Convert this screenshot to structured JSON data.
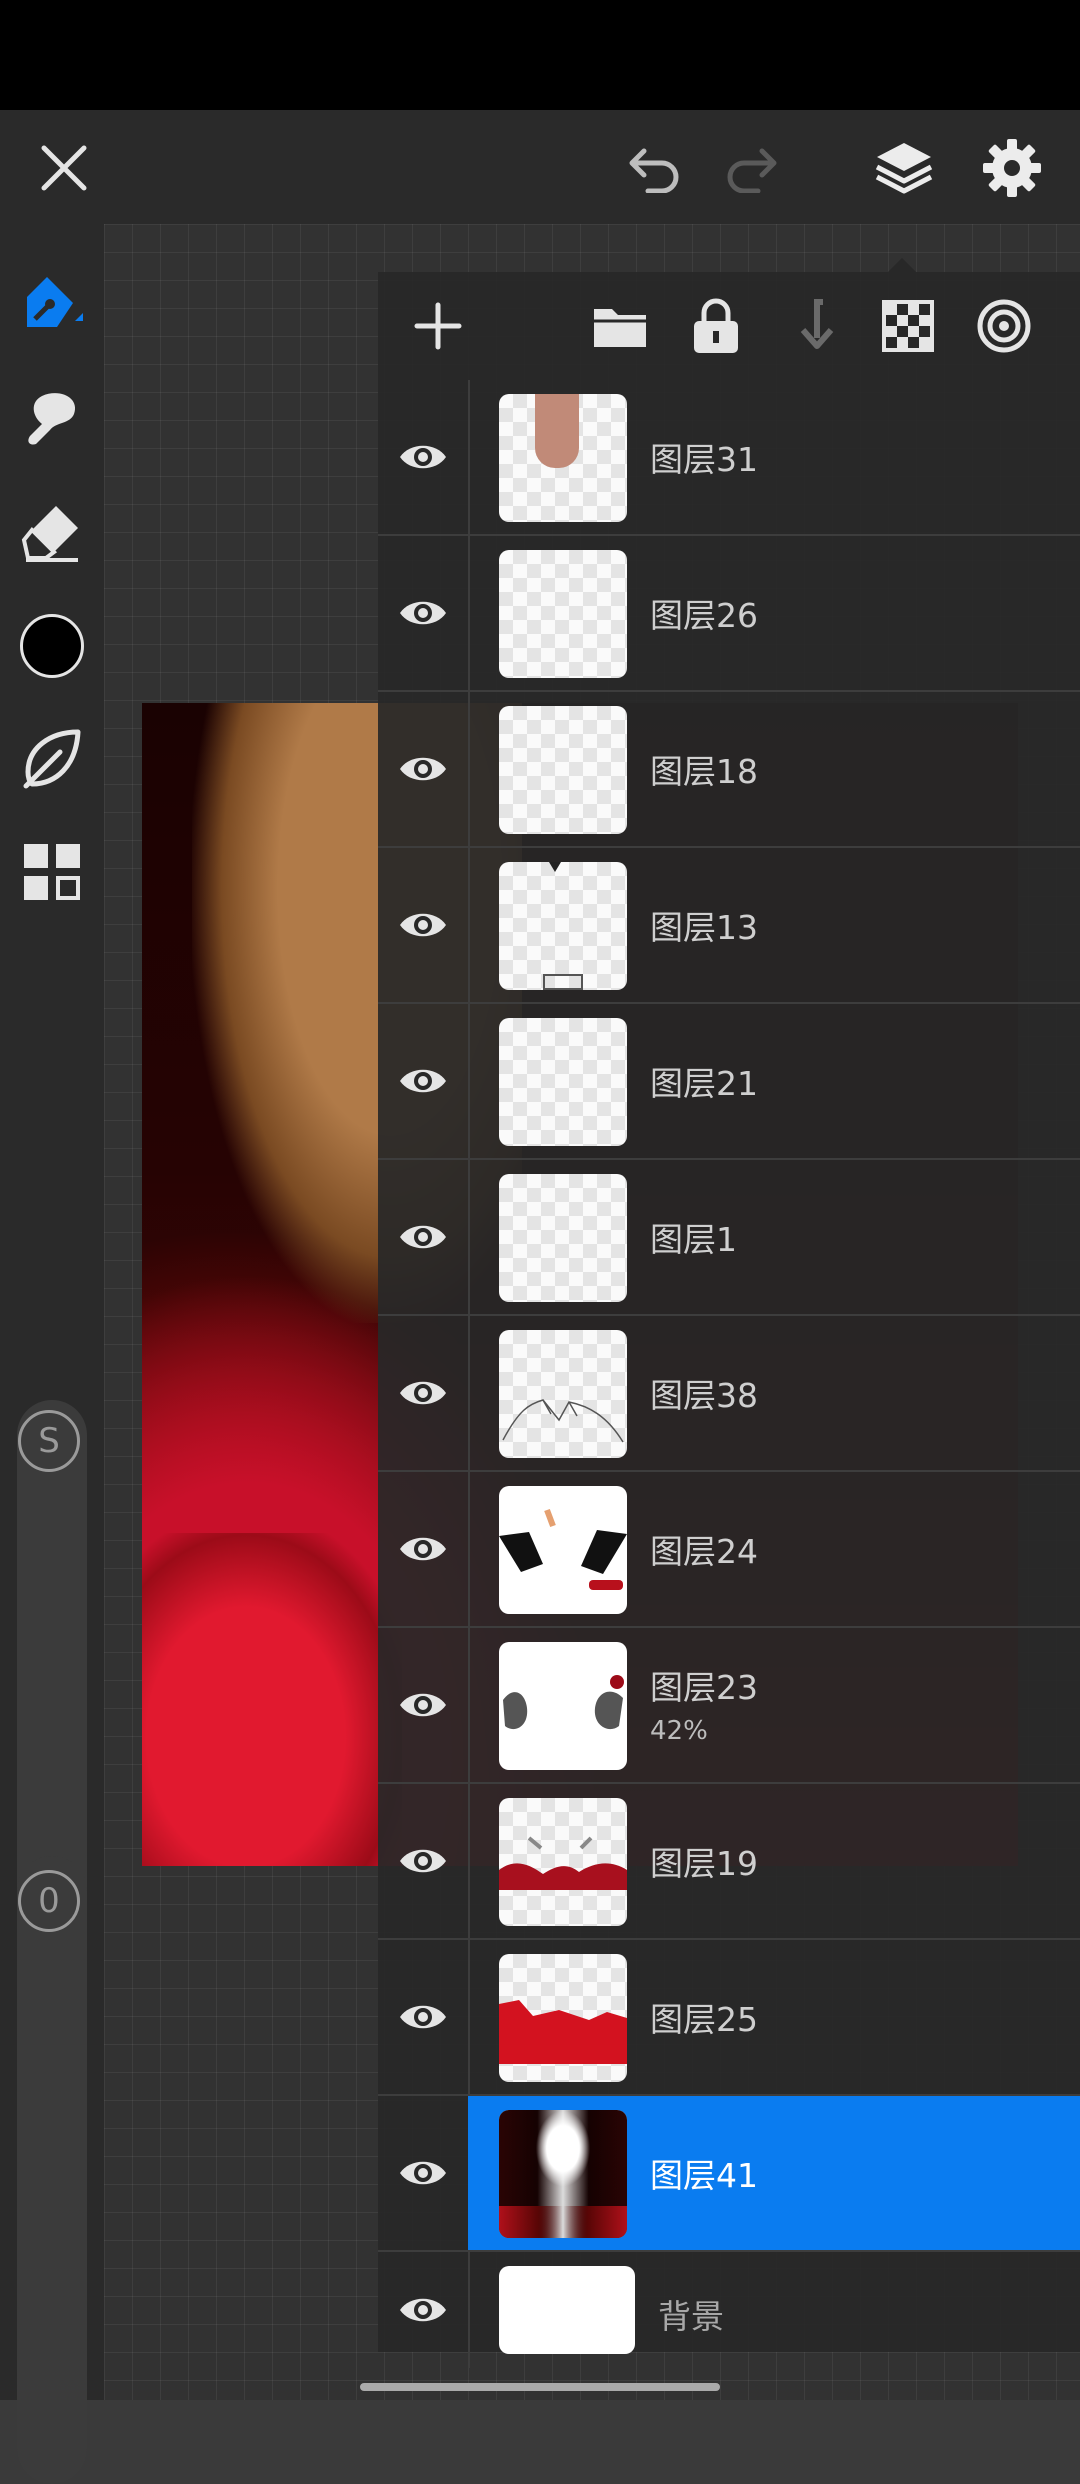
{
  "topbar": {
    "close": "close-icon",
    "undo": "undo-icon",
    "redo": "redo-icon",
    "layers": "layers-icon",
    "settings": "gear-icon"
  },
  "left_toolbar": {
    "tools": [
      "brush-pen-icon",
      "smudge-icon",
      "eraser-icon",
      "color-swatch",
      "leaf-shape-icon",
      "gallery-grid-icon"
    ],
    "active_color": "#000000",
    "size_slider_label": "S",
    "opacity_slider_label": "0"
  },
  "layer_panel": {
    "toolbar_icons": [
      "add-icon",
      "folder-icon",
      "lock-icon",
      "merge-down-icon",
      "checkerboard-icon",
      "target-icon"
    ],
    "layers": [
      {
        "name": "图层31",
        "opacity": null,
        "selected": false
      },
      {
        "name": "图层26",
        "opacity": null,
        "selected": false
      },
      {
        "name": "图层18",
        "opacity": null,
        "selected": false
      },
      {
        "name": "图层13",
        "opacity": null,
        "selected": false
      },
      {
        "name": "图层21",
        "opacity": null,
        "selected": false
      },
      {
        "name": "图层1",
        "opacity": null,
        "selected": false
      },
      {
        "name": "图层38",
        "opacity": null,
        "selected": false
      },
      {
        "name": "图层24",
        "opacity": null,
        "selected": false
      },
      {
        "name": "图层23",
        "opacity": "42%",
        "selected": false
      },
      {
        "name": "图层19",
        "opacity": null,
        "selected": false
      },
      {
        "name": "图层25",
        "opacity": null,
        "selected": false
      },
      {
        "name": "图层41",
        "opacity": null,
        "selected": true
      }
    ],
    "background": {
      "name": "背景"
    }
  },
  "colors": {
    "accent": "#0a7cf0",
    "panel": "#282828",
    "toolbar": "#2a2a2a"
  }
}
